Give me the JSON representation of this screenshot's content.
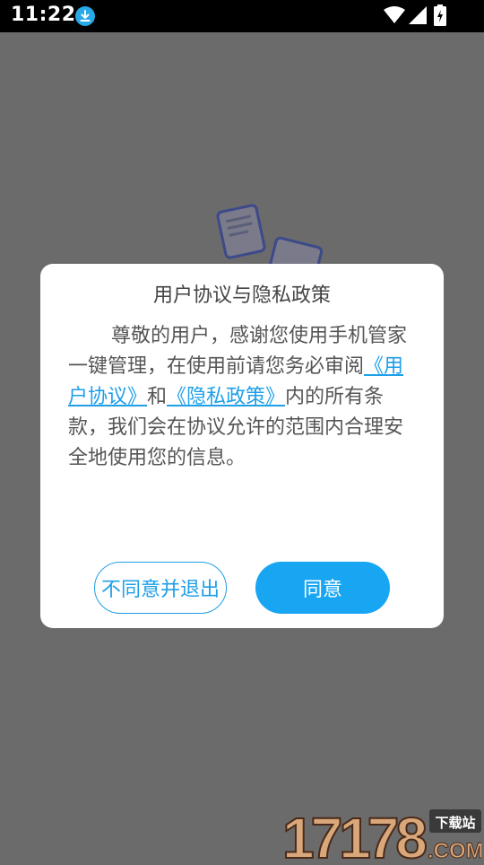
{
  "status_bar": {
    "time": "11:22"
  },
  "dialog": {
    "title": "用户协议与隐私政策",
    "body_text_1": "尊敬的用户，感谢您使用手机管家一键管理，在使用前请您务必审阅",
    "link_user_agreement": "《用户协议》",
    "body_text_2": "和",
    "link_privacy_policy": "《隐私政策》",
    "body_text_3": "内的所有条款，我们会在协议允许的范围内合理安全地使用您的信息。",
    "decline_label": "不同意并退出",
    "agree_label": "同意"
  },
  "colors": {
    "accent": "#18a5f2",
    "overlay": "#6b6b6b"
  },
  "watermark": {
    "number": "17178",
    "suffix": ".COM",
    "badge": "下载站"
  }
}
